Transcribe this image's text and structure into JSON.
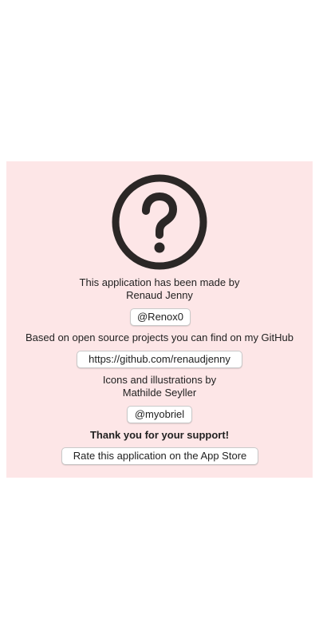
{
  "about": {
    "icon": "question-circle-icon",
    "made_by_line1": "This application has been made by",
    "made_by_line2": "Renaud Jenny",
    "author_handle": "@Renox0",
    "github_intro": "Based on open source projects you can find on my GitHub",
    "github_url": "https://github.com/renaudjenny",
    "icons_line1": "Icons and illustrations by",
    "icons_line2": "Mathilde Seyller",
    "illustrator_handle": "@myobriel",
    "thanks": "Thank you for your support!",
    "rate_button": "Rate this application on the App Store"
  },
  "colors": {
    "panel_background": "#fde6e7",
    "icon_color": "#2b2726"
  }
}
